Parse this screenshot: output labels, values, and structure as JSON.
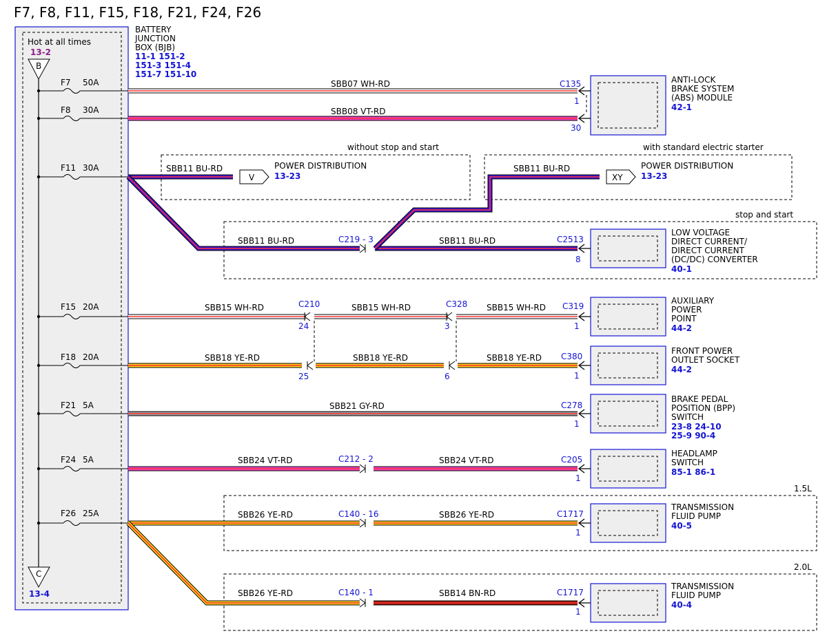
{
  "title": "F7, F8, F11, F15, F18, F21, F24, F26",
  "bjb": {
    "hot_label": "Hot at all times",
    "hot_ref": "13-2",
    "top_tag": "B",
    "bottom_tag": "C",
    "bottom_ref": "13-4",
    "name_lines": [
      "BATTERY",
      "JUNCTION",
      "BOX (BJB)"
    ],
    "refs": [
      "11-1  151-2",
      "151-3 151-4",
      "151-7  151-10"
    ]
  },
  "fuses": [
    {
      "id": "F7",
      "amps": "50A"
    },
    {
      "id": "F8",
      "amps": "30A"
    },
    {
      "id": "F11",
      "amps": "30A"
    },
    {
      "id": "F15",
      "amps": "20A"
    },
    {
      "id": "F18",
      "amps": "20A"
    },
    {
      "id": "F21",
      "amps": "5A"
    },
    {
      "id": "F24",
      "amps": "5A"
    },
    {
      "id": "F26",
      "amps": "25A"
    }
  ],
  "wires": {
    "sbb07": "SBB07  WH-RD",
    "sbb08": "SBB08  VT-RD",
    "sbb11": "SBB11  BU-RD",
    "sbb15": "SBB15  WH-RD",
    "sbb18": "SBB18  YE-RD",
    "sbb21": "SBB21  GY-RD",
    "sbb24": "SBB24  VT-RD",
    "sbb26": "SBB26  YE-RD",
    "sbb14": "SBB14  BN-RD"
  },
  "connectors": {
    "c135": "C135",
    "c135_pin1": "1",
    "c135_pin2": "30",
    "c219": "C219 - 3",
    "c2513": "C2513",
    "c2513_pin": "8",
    "c210": "C210",
    "c210_pin1": "24",
    "c210_pin2": "25",
    "c328": "C328",
    "c328_pin1": "3",
    "c328_pin2": "6",
    "c319": "C319",
    "c319_pin": "1",
    "c380": "C380",
    "c380_pin": "1",
    "c278": "C278",
    "c278_pin": "1",
    "c212": "C212 - 2",
    "c205": "C205",
    "c205_pin": "1",
    "c140a": "C140 - 16",
    "c1717a": "C1717",
    "c1717a_pin": "1",
    "c140b": "C140 - 1",
    "c1717b": "C1717",
    "c1717b_pin": "1"
  },
  "regions": {
    "without_ss": "without stop and start",
    "with_std": "with standard electric starter",
    "stop_start": "stop and start",
    "l15": "1.5L",
    "l20": "2.0L"
  },
  "power_dist": {
    "tag_v": "V",
    "tag_xy": "XY",
    "label": "POWER DISTRIBUTION",
    "ref": "13-23"
  },
  "components": {
    "abs": {
      "lines": [
        "ANTI-LOCK",
        "BRAKE SYSTEM",
        "(ABS) MODULE"
      ],
      "refs": [
        "42-1"
      ]
    },
    "dcdc": {
      "lines": [
        "LOW VOLTAGE",
        "DIRECT CURRENT/",
        "DIRECT CURRENT",
        "(DC/DC) CONVERTER"
      ],
      "refs": [
        "40-1"
      ]
    },
    "aux": {
      "lines": [
        "AUXILIARY",
        "POWER",
        "POINT"
      ],
      "refs": [
        "44-2"
      ]
    },
    "front": {
      "lines": [
        "FRONT POWER",
        "OUTLET SOCKET"
      ],
      "refs": [
        "44-2"
      ]
    },
    "bpp": {
      "lines": [
        "BRAKE PEDAL",
        "POSITION (BPP)",
        "SWITCH"
      ],
      "refs": [
        "23-8  24-10",
        "25-9  90-4"
      ]
    },
    "headlamp": {
      "lines": [
        "HEADLAMP",
        "SWITCH"
      ],
      "refs": [
        "85-1  86-1"
      ]
    },
    "tfp1": {
      "lines": [
        "TRANSMISSION",
        "FLUID PUMP"
      ],
      "refs": [
        "40-5"
      ]
    },
    "tfp2": {
      "lines": [
        "TRANSMISSION",
        "FLUID PUMP"
      ],
      "refs": [
        "40-4"
      ]
    }
  },
  "wire_colors": {
    "WH": "#ffffff",
    "RD": "#ff3030",
    "VT": "#ee44cc",
    "BU": "#3a16d0",
    "YE": "#ffd21c",
    "GY": "#9e9e9e",
    "BN": "#9a1a0e"
  }
}
